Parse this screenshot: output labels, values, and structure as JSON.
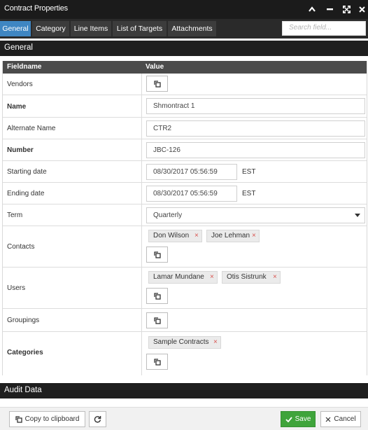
{
  "window": {
    "title": "Contract Properties"
  },
  "tabs": [
    {
      "label": "General",
      "active": true
    },
    {
      "label": "Category"
    },
    {
      "label": "Line Items"
    },
    {
      "label": "List of Targets"
    },
    {
      "label": "Attachments"
    }
  ],
  "search": {
    "placeholder": "Search field..."
  },
  "sections": {
    "general": "General",
    "audit": "Audit Data"
  },
  "grid": {
    "col_fieldname": "Fieldname",
    "col_value": "Value"
  },
  "fields": {
    "vendors": {
      "label": "Vendors"
    },
    "name": {
      "label": "Name",
      "value": "Shmontract 1"
    },
    "alternate_name": {
      "label": "Alternate Name",
      "value": "CTR2"
    },
    "number": {
      "label": "Number",
      "value": "JBC-126"
    },
    "starting_date": {
      "label": "Starting date",
      "value": "08/30/2017 05:56:59",
      "tz": "EST"
    },
    "ending_date": {
      "label": "Ending date",
      "value": "08/30/2017 05:56:59",
      "tz": "EST"
    },
    "term": {
      "label": "Term",
      "value": "Quarterly"
    },
    "contacts": {
      "label": "Contacts",
      "chips": [
        "Don Wilson",
        "Joe Lehman"
      ]
    },
    "users": {
      "label": "Users",
      "chips": [
        "Lamar Mundane",
        "Otis Sistrunk"
      ]
    },
    "groupings": {
      "label": "Groupings"
    },
    "categories": {
      "label": "Categories",
      "chips": [
        "Sample Contracts"
      ]
    }
  },
  "footer": {
    "copy_label": "Copy to clipboard",
    "save_label": "Save",
    "cancel_label": "Cancel"
  },
  "colors": {
    "active_tab": "#3f86c2",
    "save": "#3fa43b",
    "remove": "#d9534f",
    "header": "#1f1f1f"
  },
  "icons": {
    "minimize": "chevron-up-icon",
    "restore": "minus-icon",
    "maximize": "expand-icon",
    "close": "close-icon",
    "picker": "copy-icon",
    "refresh": "refresh-icon",
    "save": "check-icon",
    "cancel": "x-icon"
  }
}
